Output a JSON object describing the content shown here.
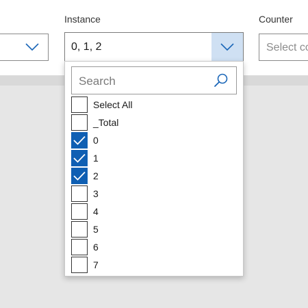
{
  "filters": {
    "left": {
      "value": ""
    },
    "instance": {
      "label": "Instance",
      "value": "0, 1, 2"
    },
    "counter": {
      "label": "Counter",
      "placeholder": "Select co"
    }
  },
  "dropdown": {
    "search_placeholder": "Search",
    "options": [
      {
        "label": "Select All",
        "checked": false
      },
      {
        "label": "_Total",
        "checked": false
      },
      {
        "label": "0",
        "checked": true
      },
      {
        "label": "1",
        "checked": true
      },
      {
        "label": "2",
        "checked": true
      },
      {
        "label": "3",
        "checked": false
      },
      {
        "label": "4",
        "checked": false
      },
      {
        "label": "5",
        "checked": false
      },
      {
        "label": "6",
        "checked": false
      },
      {
        "label": "7",
        "checked": false
      }
    ]
  },
  "colors": {
    "accent": "#0f5fb3",
    "chevron_hover": "#cfe0f3"
  }
}
